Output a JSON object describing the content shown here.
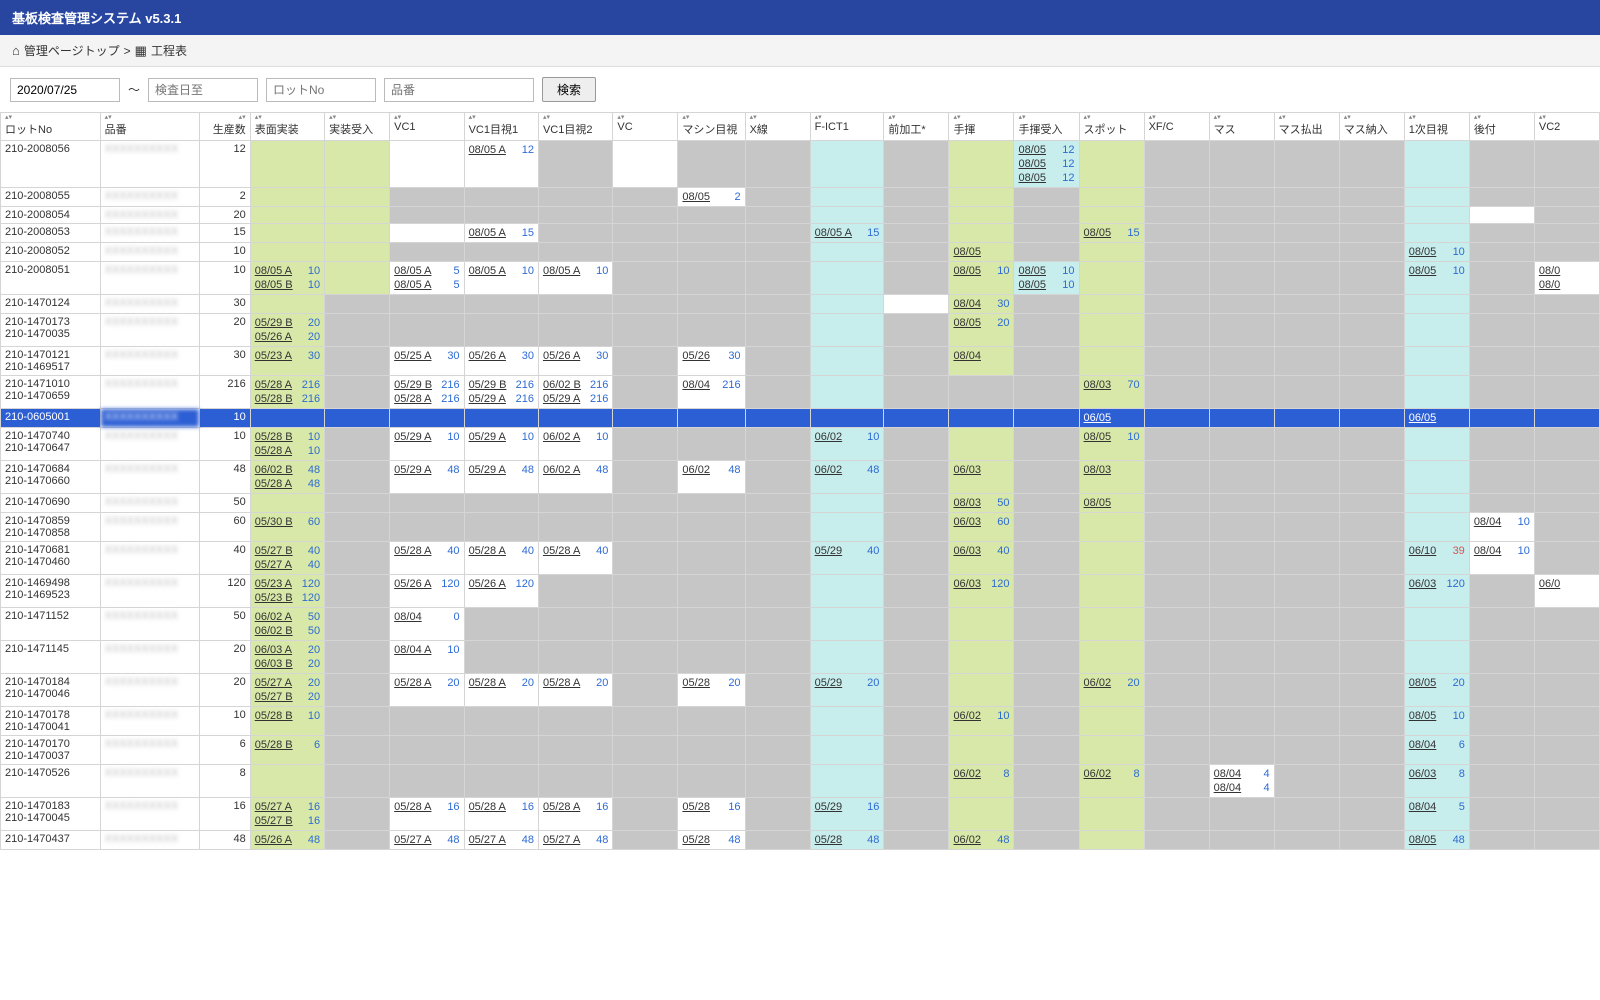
{
  "app_title": "基板検査管理システム v5.3.1",
  "breadcrumb": {
    "home": "管理ページトップ",
    "sep": ">",
    "page": "工程表"
  },
  "filters": {
    "date_from": "2020/07/25",
    "sep": "～",
    "date_to_ph": "検査日至",
    "lot_ph": "ロットNo",
    "hin_ph": "品番",
    "search": "検索"
  },
  "columns": [
    "ロットNo",
    "品番",
    "生産数",
    "表面実装",
    "実装受入",
    "VC1",
    "VC1目視1",
    "VC1目視2",
    "VC",
    "マシン目視",
    "X線",
    "F-ICT1",
    "前加工*",
    "手揮",
    "手揮受入",
    "スポット",
    "XF/C",
    "マス",
    "マス払出",
    "マス納入",
    "1次目視",
    "後付",
    "VC2"
  ],
  "rows": [
    {
      "lot": "210-2008056",
      "qty": 12,
      "c": {
        "3": "g",
        "4": "g",
        "5": "w",
        "6": [
          [
            "08/05 A",
            "12"
          ]
        ],
        "8": "w",
        "11": "c",
        "13": "g",
        "14": [
          [
            "08/05",
            "12"
          ],
          [
            "08/05",
            "12"
          ],
          [
            "08/05",
            "12"
          ]
        ],
        "15": "g",
        "20": "c"
      }
    },
    {
      "lot": "210-2008055",
      "qty": 2,
      "c": {
        "3": "g",
        "4": "g",
        "9": [
          [
            "08/05",
            "2"
          ]
        ],
        "11": "c",
        "13": "g",
        "15": "g",
        "20": "c"
      }
    },
    {
      "lot": "210-2008054",
      "qty": 20,
      "c": {
        "3": "g",
        "4": "g",
        "11": "c",
        "13": "g",
        "15": "g",
        "20": "c",
        "21": "w"
      }
    },
    {
      "lot": "210-2008053",
      "qty": 15,
      "c": {
        "3": "g",
        "4": "g",
        "5": "w",
        "6": [
          [
            "08/05 A",
            "15"
          ]
        ],
        "11": [
          [
            "08/05 A",
            "15"
          ]
        ],
        "13": "g",
        "15": [
          [
            "08/05",
            "15"
          ]
        ],
        "20": "c"
      }
    },
    {
      "lot": "210-2008052",
      "qty": 10,
      "c": {
        "3": "g",
        "4": "g",
        "11": "c",
        "13": [
          [
            "08/05",
            ""
          ]
        ],
        "15": "g",
        "20": [
          [
            "08/05",
            "10"
          ]
        ]
      }
    },
    {
      "lot": "210-2008051",
      "qty": 10,
      "c": {
        "3": [
          [
            "08/05 A",
            "10"
          ],
          [
            "08/05 B",
            "10"
          ]
        ],
        "4": "g",
        "5": [
          [
            "08/05 A",
            "5"
          ],
          [
            "08/05 A",
            "5"
          ]
        ],
        "6": [
          [
            "08/05 A",
            "10"
          ]
        ],
        "7": [
          [
            "08/05 A",
            "10"
          ]
        ],
        "11": "c",
        "13": [
          [
            "08/05",
            "10"
          ]
        ],
        "14": [
          [
            "08/05",
            "10"
          ],
          [
            "08/05",
            "10"
          ]
        ],
        "15": "g",
        "20": [
          [
            "08/05",
            "10"
          ]
        ],
        "22": [
          [
            "08/0",
            ""
          ],
          [
            "08/0",
            ""
          ]
        ]
      }
    },
    {
      "lot": "210-1470124",
      "qty": 30,
      "c": {
        "3": "g",
        "11": "c",
        "12": "w",
        "13": [
          [
            "08/04",
            "30"
          ]
        ],
        "15": "g",
        "20": "c"
      }
    },
    {
      "lot": "210-1470173",
      "sub": "210-1470035",
      "qty": 20,
      "c": {
        "3": [
          [
            "05/29 B",
            "20"
          ],
          [
            "05/26 A",
            "20"
          ]
        ],
        "11": "c",
        "13": [
          [
            "08/05",
            "20"
          ]
        ],
        "15": "g",
        "20": "c"
      }
    },
    {
      "lot": "210-1470121",
      "sub": "210-1469517",
      "qty": 30,
      "c": {
        "3": [
          [
            "05/23 A",
            "30"
          ]
        ],
        "5": [
          [
            "05/25 A",
            "30"
          ]
        ],
        "6": [
          [
            "05/26 A",
            "30"
          ]
        ],
        "7": [
          [
            "05/26 A",
            "30"
          ]
        ],
        "9": [
          [
            "05/26",
            "30"
          ]
        ],
        "11": "c",
        "13": [
          [
            "08/04",
            ""
          ]
        ],
        "15": "g",
        "20": "c"
      }
    },
    {
      "lot": "210-1471010",
      "sub": "210-1470659",
      "qty": 216,
      "c": {
        "3": [
          [
            "05/28 A",
            "216"
          ],
          [
            "05/28 B",
            "216"
          ]
        ],
        "5": [
          [
            "05/29 B",
            "216"
          ],
          [
            "05/28 A",
            "216"
          ]
        ],
        "6": [
          [
            "05/29 B",
            "216"
          ],
          [
            "05/29 A",
            "216"
          ]
        ],
        "7": [
          [
            "06/02 B",
            "216"
          ],
          [
            "05/29 A",
            "216"
          ]
        ],
        "9": [
          [
            "08/04",
            "216"
          ]
        ],
        "11": "c",
        "15": [
          [
            "08/03",
            "70"
          ]
        ],
        "20": "c"
      }
    },
    {
      "lot": "210-0605001",
      "qty": 10,
      "sel": true,
      "c": {
        "15": [
          [
            "06/05",
            ""
          ]
        ],
        "20": [
          [
            "06/05",
            ""
          ]
        ]
      }
    },
    {
      "lot": "210-1470740",
      "sub": "210-1470647",
      "qty": 10,
      "c": {
        "3": [
          [
            "05/28 B",
            "10"
          ],
          [
            "05/28 A",
            "10"
          ]
        ],
        "5": [
          [
            "05/29 A",
            "10"
          ]
        ],
        "6": [
          [
            "05/29 A",
            "10"
          ]
        ],
        "7": [
          [
            "06/02 A",
            "10"
          ]
        ],
        "11": [
          [
            "06/02",
            "10"
          ]
        ],
        "13": "g",
        "15": [
          [
            "08/05",
            "10"
          ]
        ],
        "20": "c"
      }
    },
    {
      "lot": "210-1470684",
      "sub": "210-1470660",
      "qty": 48,
      "c": {
        "3": [
          [
            "06/02 B",
            "48"
          ],
          [
            "05/28 A",
            "48"
          ]
        ],
        "5": [
          [
            "05/29 A",
            "48"
          ]
        ],
        "6": [
          [
            "05/29 A",
            "48"
          ]
        ],
        "7": [
          [
            "06/02 A",
            "48"
          ]
        ],
        "9": [
          [
            "06/02",
            "48"
          ]
        ],
        "11": [
          [
            "06/02",
            "48"
          ]
        ],
        "13": [
          [
            "06/03",
            ""
          ]
        ],
        "15": [
          [
            "08/03",
            ""
          ]
        ],
        "20": "c"
      }
    },
    {
      "lot": "210-1470690",
      "qty": 50,
      "c": {
        "3": "g",
        "11": "c",
        "13": [
          [
            "08/03",
            "50"
          ]
        ],
        "15": [
          [
            "08/05",
            ""
          ]
        ],
        "20": "c"
      }
    },
    {
      "lot": "210-1470859",
      "sub": "210-1470858",
      "qty": 60,
      "c": {
        "3": [
          [
            "05/30 B",
            "60"
          ]
        ],
        "11": "c",
        "13": [
          [
            "06/03",
            "60"
          ]
        ],
        "15": "g",
        "20": "c",
        "21": [
          [
            "08/04",
            "10"
          ]
        ]
      }
    },
    {
      "lot": "210-1470681",
      "sub": "210-1470460",
      "qty": 40,
      "c": {
        "3": [
          [
            "05/27 B",
            "40"
          ],
          [
            "05/27 A",
            "40"
          ]
        ],
        "5": [
          [
            "05/28 A",
            "40"
          ]
        ],
        "6": [
          [
            "05/28 A",
            "40"
          ]
        ],
        "7": [
          [
            "05/28 A",
            "40"
          ]
        ],
        "11": [
          [
            "05/29",
            "40"
          ]
        ],
        "13": [
          [
            "06/03",
            "40"
          ]
        ],
        "15": "g",
        "20": [
          [
            "06/10",
            "39",
            "red"
          ]
        ],
        "21": [
          [
            "08/04",
            "10"
          ]
        ]
      }
    },
    {
      "lot": "210-1469498",
      "sub": "210-1469523",
      "qty": 120,
      "c": {
        "3": [
          [
            "05/23 A",
            "120"
          ],
          [
            "05/23 B",
            "120"
          ]
        ],
        "5": [
          [
            "05/26 A",
            "120"
          ]
        ],
        "6": [
          [
            "05/26 A",
            "120"
          ]
        ],
        "11": "c",
        "13": [
          [
            "06/03",
            "120"
          ]
        ],
        "15": "g",
        "20": [
          [
            "06/03",
            "120"
          ]
        ],
        "22": [
          [
            "06/0",
            ""
          ]
        ]
      }
    },
    {
      "lot": "210-1471152",
      "qty": 50,
      "c": {
        "3": [
          [
            "06/02 A",
            "50"
          ],
          [
            "06/02 B",
            "50"
          ]
        ],
        "5": [
          [
            "08/04",
            "0"
          ]
        ],
        "11": "c",
        "13": "g",
        "15": "g",
        "20": "c"
      }
    },
    {
      "lot": "210-1471145",
      "qty": 20,
      "c": {
        "3": [
          [
            "06/03 A",
            "20"
          ],
          [
            "06/03 B",
            "20"
          ]
        ],
        "5": [
          [
            "08/04 A",
            "10"
          ]
        ],
        "11": "c",
        "13": "g",
        "15": "g",
        "20": "c"
      }
    },
    {
      "lot": "210-1470184",
      "sub": "210-1470046",
      "qty": 20,
      "c": {
        "3": [
          [
            "05/27 A",
            "20"
          ],
          [
            "05/27 B",
            "20"
          ]
        ],
        "5": [
          [
            "05/28 A",
            "20"
          ]
        ],
        "6": [
          [
            "05/28 A",
            "20"
          ]
        ],
        "7": [
          [
            "05/28 A",
            "20"
          ]
        ],
        "9": [
          [
            "05/28",
            "20"
          ]
        ],
        "11": [
          [
            "05/29",
            "20"
          ]
        ],
        "13": "g",
        "15": [
          [
            "06/02",
            "20"
          ]
        ],
        "20": [
          [
            "08/05",
            "20"
          ]
        ]
      }
    },
    {
      "lot": "210-1470178",
      "sub": "210-1470041",
      "qty": 10,
      "c": {
        "3": [
          [
            "05/28 B",
            "10"
          ]
        ],
        "11": "c",
        "13": [
          [
            "06/02",
            "10"
          ]
        ],
        "15": "g",
        "20": [
          [
            "08/05",
            "10"
          ]
        ]
      }
    },
    {
      "lot": "210-1470170",
      "sub": "210-1470037",
      "qty": 6,
      "c": {
        "3": [
          [
            "05/28 B",
            "6"
          ]
        ],
        "11": "c",
        "13": "g",
        "15": "g",
        "20": [
          [
            "08/04",
            "6"
          ]
        ]
      }
    },
    {
      "lot": "210-1470526",
      "qty": 8,
      "c": {
        "3": "g",
        "11": "c",
        "13": [
          [
            "06/02",
            "8"
          ]
        ],
        "15": [
          [
            "06/02",
            "8"
          ]
        ],
        "17": [
          [
            "08/04",
            "4"
          ],
          [
            "08/04",
            "4"
          ]
        ],
        "20": [
          [
            "06/03",
            "8"
          ]
        ]
      }
    },
    {
      "lot": "210-1470183",
      "sub": "210-1470045",
      "qty": 16,
      "c": {
        "3": [
          [
            "05/27 A",
            "16"
          ],
          [
            "05/27 B",
            "16"
          ]
        ],
        "5": [
          [
            "05/28 A",
            "16"
          ]
        ],
        "6": [
          [
            "05/28 A",
            "16"
          ]
        ],
        "7": [
          [
            "05/28 A",
            "16"
          ]
        ],
        "9": [
          [
            "05/28",
            "16"
          ]
        ],
        "11": [
          [
            "05/29",
            "16"
          ]
        ],
        "13": "g",
        "15": "g",
        "20": [
          [
            "08/04",
            "5"
          ]
        ]
      }
    },
    {
      "lot": "210-1470437",
      "qty": 48,
      "c": {
        "3": [
          [
            "05/26 A",
            "48"
          ]
        ],
        "5": [
          [
            "05/27 A",
            "48"
          ]
        ],
        "6": [
          [
            "05/27 A",
            "48"
          ]
        ],
        "7": [
          [
            "05/27 A",
            "48"
          ]
        ],
        "9": [
          [
            "05/28",
            "48"
          ]
        ],
        "11": [
          [
            "05/28",
            "48"
          ]
        ],
        "13": [
          [
            "06/02",
            "48"
          ]
        ],
        "15": "g",
        "20": [
          [
            "08/05",
            "48"
          ]
        ]
      }
    }
  ]
}
